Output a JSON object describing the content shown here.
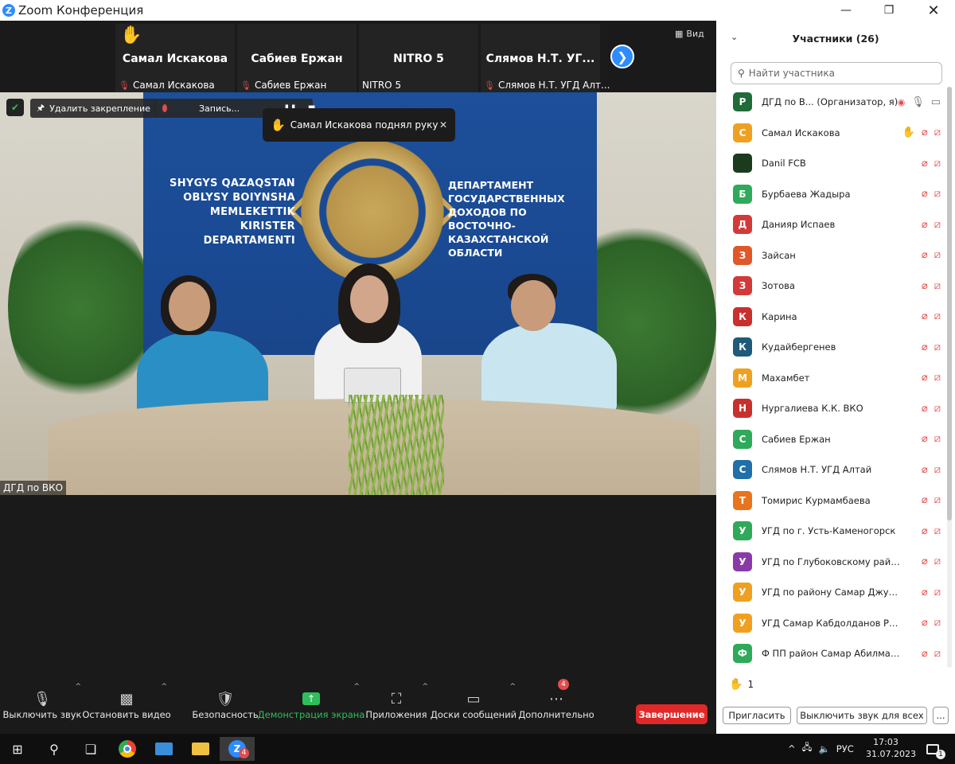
{
  "window": {
    "title": "Zoom Конференция"
  },
  "strip": {
    "tiles": [
      {
        "big": "Самал Искакова",
        "small": "Самал Искакова",
        "muted": true,
        "hand": true
      },
      {
        "big": "Сабиев Ержан",
        "small": "Сабиев Ержан",
        "muted": true,
        "hand": false
      },
      {
        "big": "NITRO 5",
        "small": "NITRO 5",
        "muted": false,
        "hand": false
      },
      {
        "big": "Слямов Н.Т. УГ...",
        "small": "Слямов Н.Т. УГД Алт...",
        "muted": true,
        "hand": false
      }
    ],
    "view_label": "Вид"
  },
  "video": {
    "backdrop_left": [
      "SHYGYS QAZAQSTAN",
      "OBLYSY BOIYNSHA",
      "MEMLEKETTIK",
      "KIRISTER",
      "DEPARTAMENTI"
    ],
    "backdrop_right": [
      "ДЕПАРТАМЕНТ",
      "ГОСУДАРСТВЕННЫХ",
      "ДОХОДОВ ПО",
      "ВОСТОЧНО-КАЗАХСТАНСКОЙ",
      "ОБЛАСТИ"
    ],
    "speaker_label": "ДГД по ВКО",
    "unpin_label": "Удалить закрепление",
    "recording_label": "Запись...",
    "toast_text": "Самал Искакова поднял руку"
  },
  "toolbar": {
    "mute": "Выключить звук",
    "video": "Остановить видео",
    "security": "Безопасность",
    "share": "Демонстрация экрана",
    "apps": "Приложения",
    "whiteboards": "Доски сообщений",
    "more": "Дополнительно",
    "more_badge": "4",
    "end": "Завершение"
  },
  "panel": {
    "title": "Участники (26)",
    "search_placeholder": "Найти участника",
    "participants": [
      {
        "initial": "Р",
        "color": "#1f6b3a",
        "name": "ДГД по В... (Организатор, я)",
        "mic_on": true,
        "cam_on": true,
        "recording": true,
        "hand": false
      },
      {
        "initial": "С",
        "color": "#f0a020",
        "name": "Самал Искакова",
        "mic_on": false,
        "cam_on": false,
        "recording": false,
        "hand": true
      },
      {
        "initial": "",
        "color": "#1c3a1c",
        "name": "Danil FCB",
        "mic_on": false,
        "cam_on": false,
        "recording": false,
        "hand": false
      },
      {
        "initial": "Б",
        "color": "#2eaa5a",
        "name": "Бурбаева Жадыра",
        "mic_on": false,
        "cam_on": false,
        "recording": false,
        "hand": false
      },
      {
        "initial": "Д",
        "color": "#d23a3a",
        "name": "Данияр Испаев",
        "mic_on": false,
        "cam_on": false,
        "recording": false,
        "hand": false
      },
      {
        "initial": "З",
        "color": "#e0582a",
        "name": "Зайсан",
        "mic_on": false,
        "cam_on": false,
        "recording": false,
        "hand": false
      },
      {
        "initial": "З",
        "color": "#d23a3a",
        "name": "Зотова",
        "mic_on": false,
        "cam_on": false,
        "recording": false,
        "hand": false
      },
      {
        "initial": "К",
        "color": "#c8302e",
        "name": "Карина",
        "mic_on": false,
        "cam_on": false,
        "recording": false,
        "hand": false
      },
      {
        "initial": "К",
        "color": "#1f5a7a",
        "name": "Кудайбергенев",
        "mic_on": false,
        "cam_on": false,
        "recording": false,
        "hand": false
      },
      {
        "initial": "М",
        "color": "#f0a020",
        "name": "Махамбет",
        "mic_on": false,
        "cam_on": false,
        "recording": false,
        "hand": false
      },
      {
        "initial": "Н",
        "color": "#c8302e",
        "name": "Нургалиева К.К. ВКО",
        "mic_on": false,
        "cam_on": false,
        "recording": false,
        "hand": false
      },
      {
        "initial": "С",
        "color": "#2eaa5a",
        "name": "Сабиев Ержан",
        "mic_on": false,
        "cam_on": false,
        "recording": false,
        "hand": false
      },
      {
        "initial": "С",
        "color": "#1f6fa8",
        "name": "Слямов Н.Т. УГД Алтай",
        "mic_on": false,
        "cam_on": false,
        "recording": false,
        "hand": false
      },
      {
        "initial": "Т",
        "color": "#e8741e",
        "name": "Томирис Курмамбаева",
        "mic_on": false,
        "cam_on": false,
        "recording": false,
        "hand": false
      },
      {
        "initial": "У",
        "color": "#2eaa5a",
        "name": "УГД по г. Усть-Каменогорск",
        "mic_on": false,
        "cam_on": false,
        "recording": false,
        "hand": false
      },
      {
        "initial": "У",
        "color": "#8a3aa8",
        "name": "УГД по Глубоковскому район...",
        "mic_on": false,
        "cam_on": false,
        "recording": false,
        "hand": false
      },
      {
        "initial": "У",
        "color": "#f0a020",
        "name": "УГД по району Самар Джусип...",
        "mic_on": false,
        "cam_on": false,
        "recording": false,
        "hand": false
      },
      {
        "initial": "У",
        "color": "#f0a020",
        "name": "УГД Самар Кабдолданов Русл...",
        "mic_on": false,
        "cam_on": false,
        "recording": false,
        "hand": false
      },
      {
        "initial": "Ф",
        "color": "#2eaa5a",
        "name": "Ф ПП район Самар Абилмажи...",
        "mic_on": false,
        "cam_on": false,
        "recording": false,
        "hand": false
      }
    ],
    "raised_count": "1",
    "invite": "Пригласить",
    "mute_all": "Выключить звук для всех",
    "more": "..."
  },
  "taskbar": {
    "zoom_badge": "4",
    "lang": "РУС",
    "time": "17:03",
    "date": "31.07.2023",
    "notif_count": "1"
  }
}
